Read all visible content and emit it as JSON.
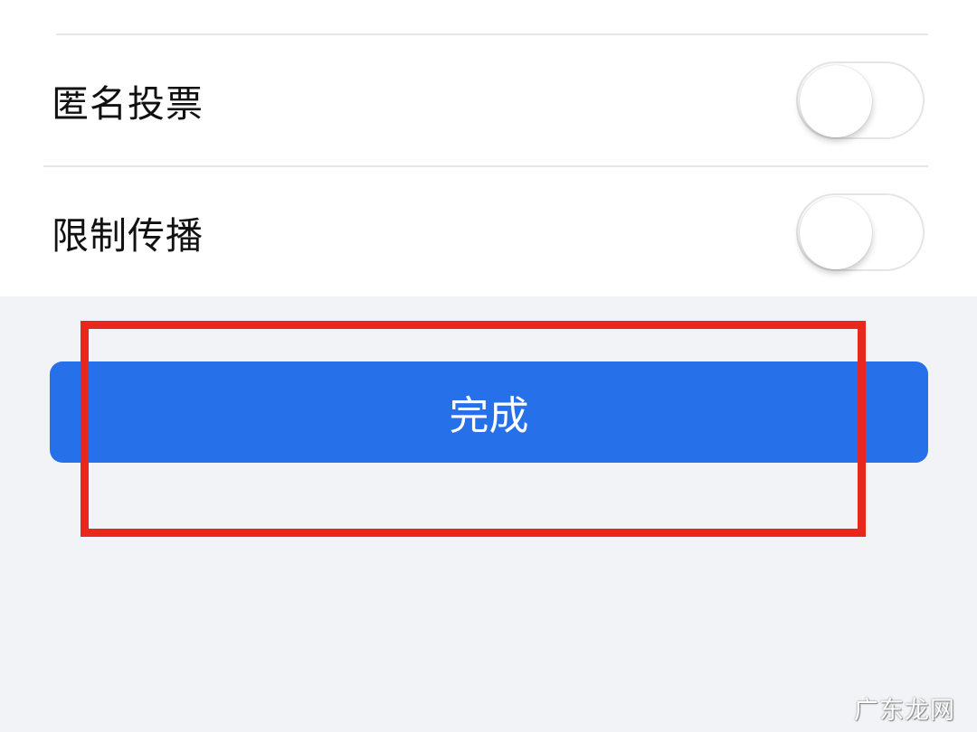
{
  "settings": {
    "rows": [
      {
        "label": "匿名投票",
        "enabled": false
      },
      {
        "label": "限制传播",
        "enabled": false
      }
    ]
  },
  "done_button": {
    "label": "完成",
    "color": "#2670ea"
  },
  "highlight": {
    "color": "#e8281c"
  },
  "watermark": {
    "text": "广东龙网"
  }
}
